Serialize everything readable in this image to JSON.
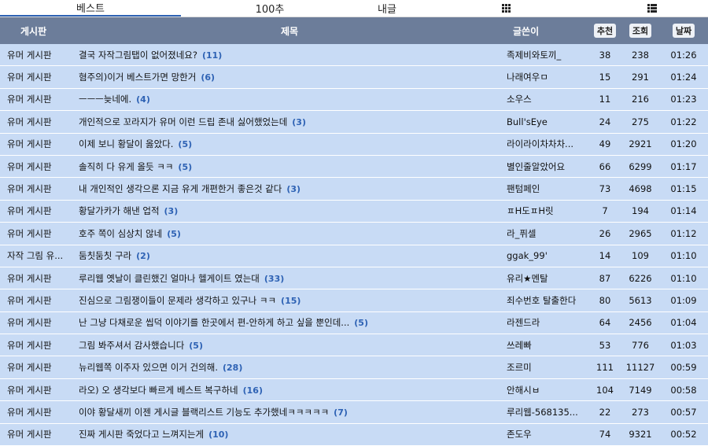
{
  "tabs": {
    "best": "베스트",
    "top100": "100추",
    "mine": "내글"
  },
  "header": {
    "board": "게시판",
    "title": "제목",
    "author": "글쓴이",
    "rec": "추천",
    "views": "조회",
    "date": "날짜"
  },
  "rows": [
    {
      "board": "유머 게시판",
      "title": "결국 자작그림탭이 없어졌네요?",
      "comments": "(11)",
      "author": "족제비와토끼_",
      "rec": "38",
      "views": "238",
      "date": "01:26"
    },
    {
      "board": "유머 게시판",
      "title": "혐주의)이거 베스트가면 망한거",
      "comments": "(6)",
      "author": "나래여우ㅁ",
      "rec": "15",
      "views": "291",
      "date": "01:24"
    },
    {
      "board": "유머 게시판",
      "title": "ㅡㅡㅡ늦네에.",
      "comments": "(4)",
      "author": "소우스",
      "rec": "11",
      "views": "216",
      "date": "01:23"
    },
    {
      "board": "유머 게시판",
      "title": "개인적으로 꼬라지가 유머 이런 드립 존내 싫어했었는데",
      "comments": "(3)",
      "author": "Bull'sEye",
      "rec": "24",
      "views": "275",
      "date": "01:22"
    },
    {
      "board": "유머 게시판",
      "title": "이제 보니 황달이 옳았다.",
      "comments": "(5)",
      "author": "라이라이차차차...",
      "rec": "49",
      "views": "2921",
      "date": "01:20"
    },
    {
      "board": "유머 게시판",
      "title": "솔직히 다 유게 올듯 ㅋㅋ",
      "comments": "(5)",
      "author": "별인줄알았어요",
      "rec": "66",
      "views": "6299",
      "date": "01:17"
    },
    {
      "board": "유머 게시판",
      "title": "내 개인적인 생각으론 지금 유게 개편한거 좋은것 같다",
      "comments": "(3)",
      "author": "팬텀페인",
      "rec": "73",
      "views": "4698",
      "date": "01:15"
    },
    {
      "board": "유머 게시판",
      "title": "황달가카가 해낸 업적",
      "comments": "(3)",
      "author": "ㅍH도ㅍH릿",
      "rec": "7",
      "views": "194",
      "date": "01:14"
    },
    {
      "board": "유머 게시판",
      "title": "호주 쪽이 심상치 않네",
      "comments": "(5)",
      "author": "라_퓌셀",
      "rec": "26",
      "views": "2965",
      "date": "01:12"
    },
    {
      "board": "자작 그림 유...",
      "title": "둠칫둠칫 구라",
      "comments": "(2)",
      "author": "ggak_99'",
      "rec": "14",
      "views": "109",
      "date": "01:10"
    },
    {
      "board": "유머 게시판",
      "title": "루리웹 옛날이 클린했긴 얼마나 헬게이트 였는대",
      "comments": "(33)",
      "author": "유리★멘탈",
      "rec": "87",
      "views": "6226",
      "date": "01:10"
    },
    {
      "board": "유머 게시판",
      "title": "진심으로 그림쟁이들이 문제라 생각하고 있구나 ㅋㅋ",
      "comments": "(15)",
      "author": "죄수번호 탈출한다",
      "rec": "80",
      "views": "5613",
      "date": "01:09"
    },
    {
      "board": "유머 게시판",
      "title": "난 그냥 다채로운 씹덕 이야기를 한곳에서 편-안하게 하고 싶을 뿐인데...",
      "comments": "(5)",
      "author": "라젠드라",
      "rec": "64",
      "views": "2456",
      "date": "01:04"
    },
    {
      "board": "유머 게시판",
      "title": "그림 봐주셔서 감사했습니다",
      "comments": "(5)",
      "author": "쓰레빠",
      "rec": "53",
      "views": "776",
      "date": "01:03"
    },
    {
      "board": "유머 게시판",
      "title": "뉴리웹쪽 이주자 있으면 이거 건의해.",
      "comments": "(28)",
      "author": "조르미",
      "rec": "111",
      "views": "11127",
      "date": "00:59"
    },
    {
      "board": "유머 게시판",
      "title": "라오) 오 생각보다 빠르게 베스트 복구하네",
      "comments": "(16)",
      "author": "안해시ㅂ",
      "rec": "104",
      "views": "7149",
      "date": "00:58"
    },
    {
      "board": "유머 게시판",
      "title": "이야 황달새끼 이젠 게시글 블랙리스트 기능도 추가했네ㅋㅋㅋㅋㅋ",
      "comments": "(7)",
      "author": "루리웹-568135...",
      "rec": "22",
      "views": "273",
      "date": "00:57"
    },
    {
      "board": "유머 게시판",
      "title": "진짜 게시판 죽었다고 느껴지는게",
      "comments": "(10)",
      "author": "존도우",
      "rec": "74",
      "views": "9321",
      "date": "00:52"
    }
  ]
}
